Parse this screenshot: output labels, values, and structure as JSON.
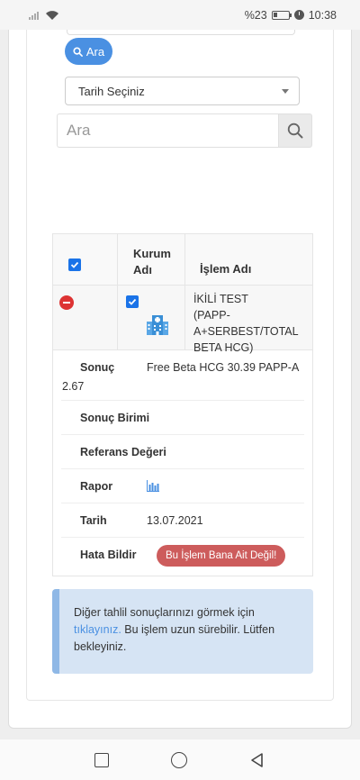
{
  "status_bar": {
    "battery_text": "%23",
    "time": "10:38"
  },
  "search_button": {
    "label": "Ara",
    "icon": "search-icon",
    "color": "#4a90e2"
  },
  "date_select": {
    "selected": "Tarih Seçiniz"
  },
  "search_box": {
    "placeholder": "Ara",
    "icon": "search-icon"
  },
  "table": {
    "headers": {
      "col2": "Kurum Adı",
      "col3": "İşlem Adı"
    },
    "row": {
      "islem_name": "İKİLİ TEST (PAPP-A+SERBEST/TOTAL BETA HCG)",
      "kurum_icon": "hospital-building-icon"
    },
    "details": {
      "sonuc_label": "Sonuç",
      "sonuc_value_line1": "Free Beta HCG 30.39 PAPP-A",
      "sonuc_value_line2": "2.67",
      "birim_label": "Sonuç Birimi",
      "referans_label": "Referans Değeri",
      "rapor_label": "Rapor",
      "rapor_icon": "bar-chart-icon",
      "tarih_label": "Tarih",
      "tarih_value": "13.07.2021",
      "hata_label": "Hata Bildir",
      "hata_button": "Bu İşlem Bana Ait Değil!",
      "hata_button_color": "#cd5c5c"
    }
  },
  "alert": {
    "text_before": "Diğer tahlil sonuçlarınızı görmek için ",
    "link_text": "tıklayınız.",
    "text_after": " Bu işlem uzun sürebilir. Lütfen bekleyiniz."
  },
  "colors": {
    "accent": "#4a90e2",
    "danger": "#d33333",
    "alert_bg": "#d6e4f4"
  }
}
